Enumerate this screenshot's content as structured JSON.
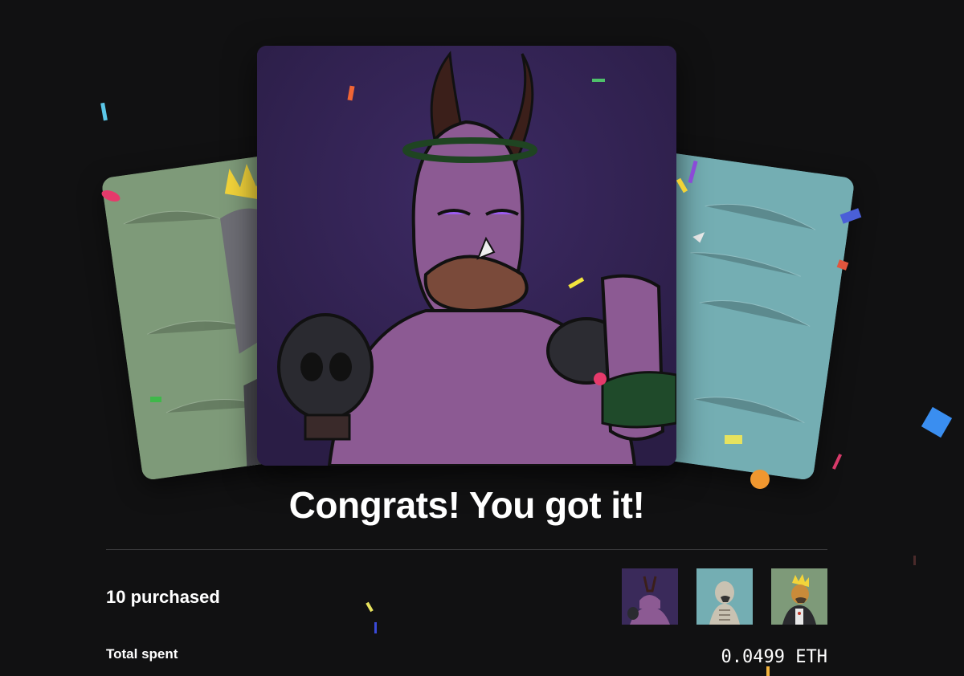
{
  "congrats": {
    "title": "Congrats! You got it!"
  },
  "summary": {
    "purchased_label": "10 purchased",
    "total_spent_label": "Total spent",
    "total_spent_value": "0.0499 ETH"
  },
  "nfts": {
    "featured": {
      "subject": "purple duck with horns and thorns",
      "background": "#3a2a5a"
    },
    "left": {
      "subject": "duck with yellow hair",
      "background": "#7e9a79"
    },
    "right": {
      "subject": "duck on teal background",
      "background": "#74aeb3"
    }
  },
  "thumbnails": [
    {
      "subject": "purple duck with horns",
      "background": "#3a2a5a"
    },
    {
      "subject": "pale skeletal duck",
      "background": "#74aeb3"
    },
    {
      "subject": "duck with yellow hair",
      "background": "#7e9a79"
    }
  ]
}
